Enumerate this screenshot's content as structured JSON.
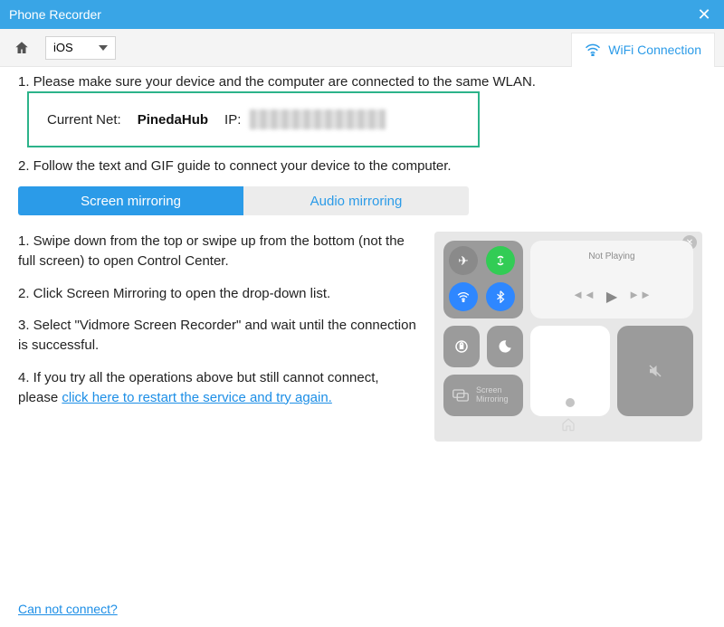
{
  "window": {
    "title": "Phone Recorder"
  },
  "toolbar": {
    "os_label": "iOS",
    "wifi_tab": "WiFi Connection"
  },
  "step1": "1. Please make sure your device and the computer are connected to the same WLAN.",
  "net": {
    "current_label": "Current Net:",
    "name": "PinedaHub",
    "ip_label": "IP:"
  },
  "step2": "2. Follow the text and GIF guide to connect your device to the computer.",
  "tabs": {
    "screen": "Screen mirroring",
    "audio": "Audio mirroring"
  },
  "guide": {
    "p1": "1. Swipe down from the top or swipe up from the bottom (not the full screen) to open Control Center.",
    "p2": "2. Click Screen Mirroring to open the drop-down list.",
    "p3": "3. Select \"Vidmore Screen Recorder\" and wait until the connection is successful.",
    "p4a": "4. If you try all the operations above but still cannot connect, please ",
    "p4link": "click here to restart the service and try again."
  },
  "cc": {
    "not_playing": "Not Playing",
    "screen_mirroring": "Screen Mirroring"
  },
  "footer": {
    "cannot_connect": "Can not connect?"
  }
}
